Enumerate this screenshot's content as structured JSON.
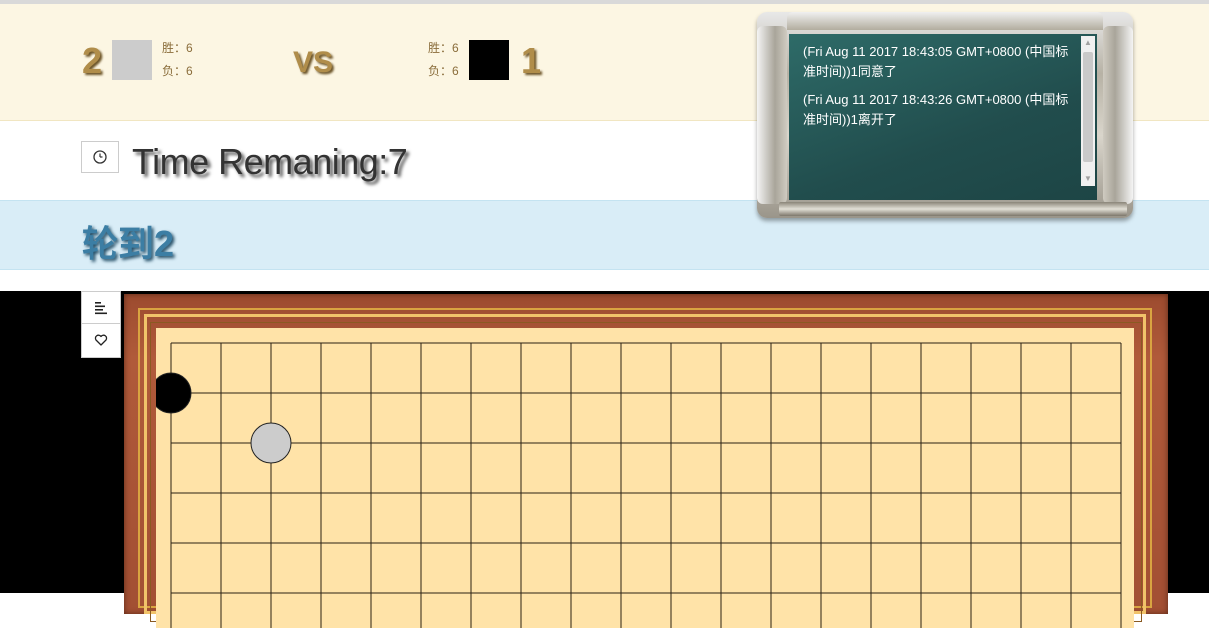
{
  "scoreboard": {
    "player_left": {
      "score": "2",
      "win_label": "胜：6",
      "loss_label": "负：6",
      "color": "#cccccc"
    },
    "vs_label": "VS",
    "player_right": {
      "score": "1",
      "win_label": "胜：6",
      "loss_label": "负：6",
      "color": "#000000"
    }
  },
  "timer": {
    "icon": "clock-icon",
    "text": "Time Remaning:7"
  },
  "turn": {
    "text": "轮到2"
  },
  "chat": {
    "messages": [
      "(Fri Aug 11 2017 18:43:05 GMT+0800 (中国标准时间))1同意了",
      "(Fri Aug 11 2017 18:43:26 GMT+0800 (中国标准时间))1离开了"
    ]
  },
  "toolbar": [
    {
      "icon": "align-left-icon"
    },
    {
      "icon": "heart-icon"
    }
  ],
  "board": {
    "line_color": "#2b2012",
    "stones": [
      {
        "col": 0,
        "row": 1,
        "color": "#000000"
      },
      {
        "col": 2,
        "row": 2,
        "color": "#cccccc"
      }
    ]
  }
}
